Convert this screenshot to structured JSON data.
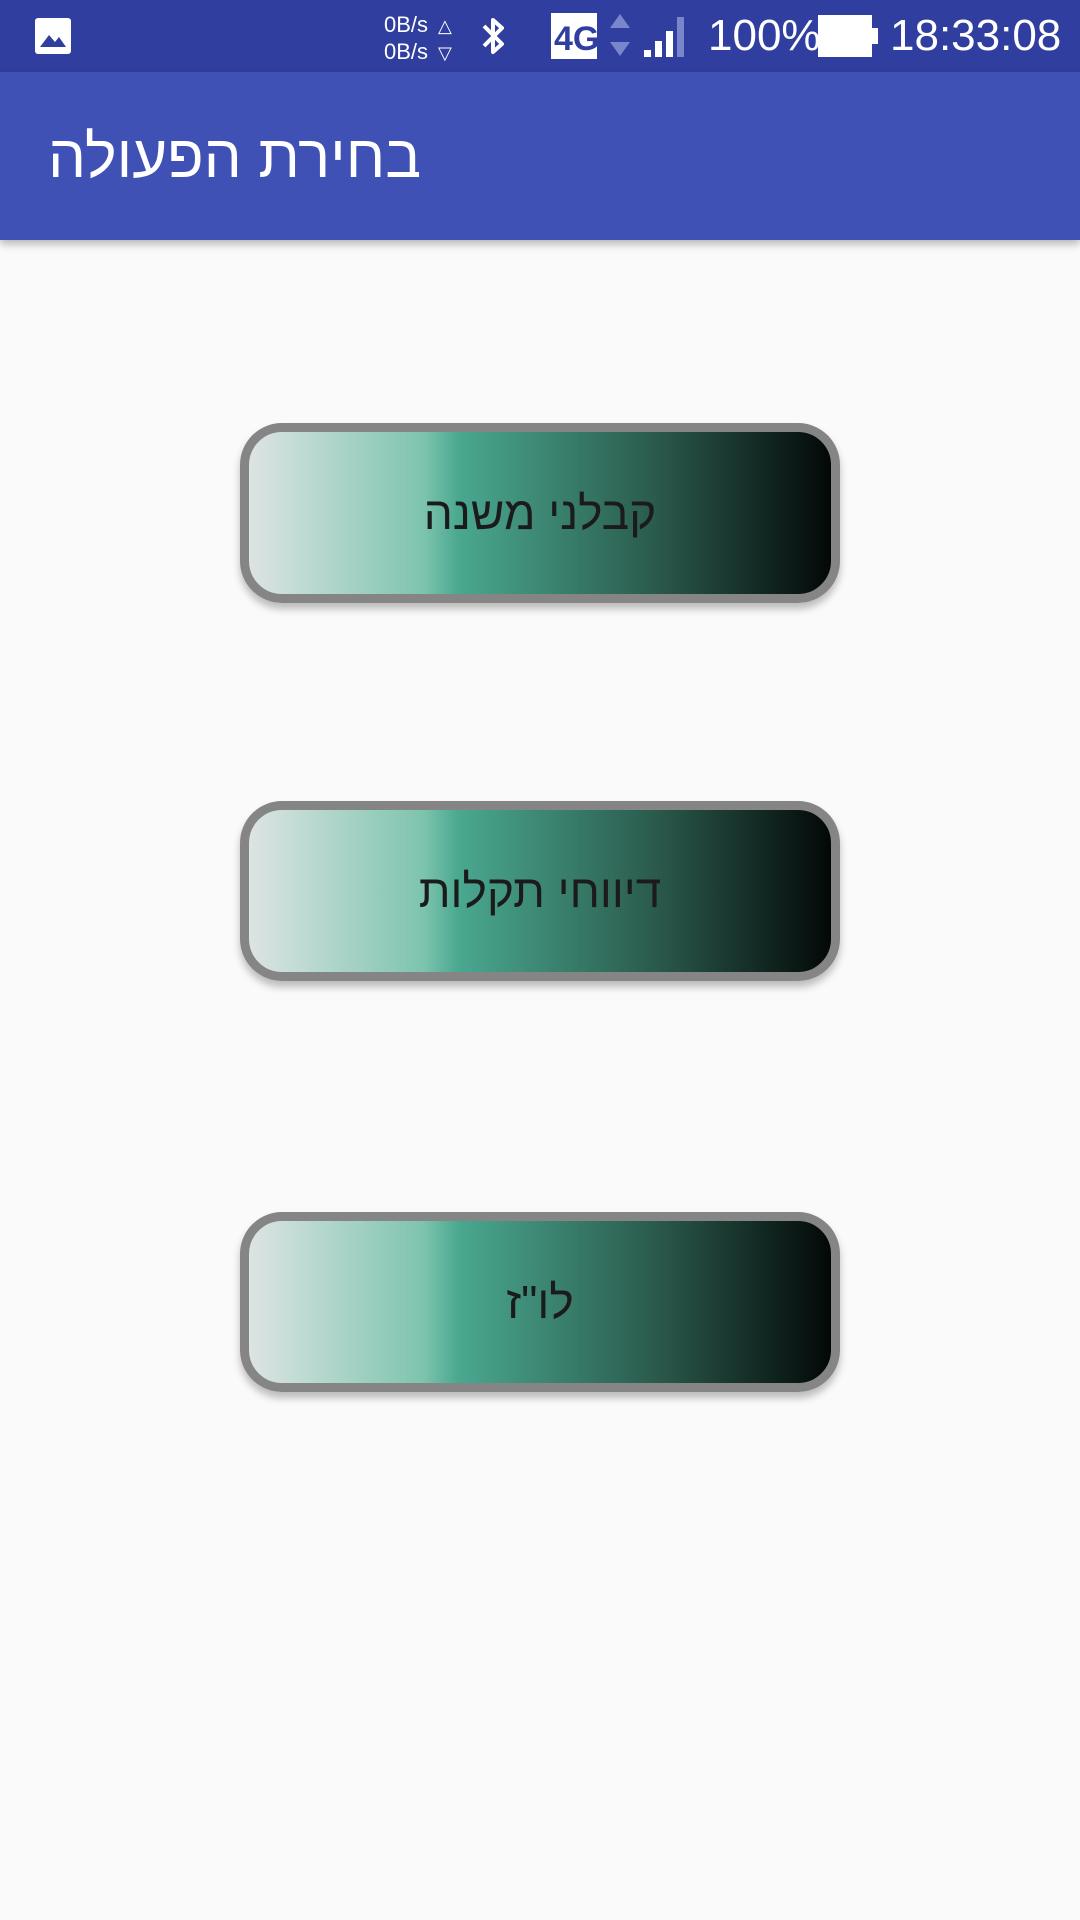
{
  "status_bar": {
    "upload_speed": "0B/s",
    "download_speed": "0B/s",
    "network_type": "4G",
    "battery_percent": "100%",
    "time": "18:33:08",
    "icons": [
      "gallery-icon",
      "bluetooth-icon",
      "lte-icon",
      "signal-icon",
      "battery-icon"
    ]
  },
  "app_bar": {
    "title": "בחירת הפעולה",
    "color": "#3f51b5"
  },
  "buttons": [
    {
      "label": "קבלני משנה"
    },
    {
      "label": "דיווחי תקלות"
    },
    {
      "label": "לו\"ז"
    }
  ],
  "colors": {
    "status_bar": "#303f9f",
    "background": "#fafafa",
    "button_border": "#858585",
    "button_gradient": [
      "#dde4e4",
      "#4aa890",
      "#030807"
    ]
  }
}
